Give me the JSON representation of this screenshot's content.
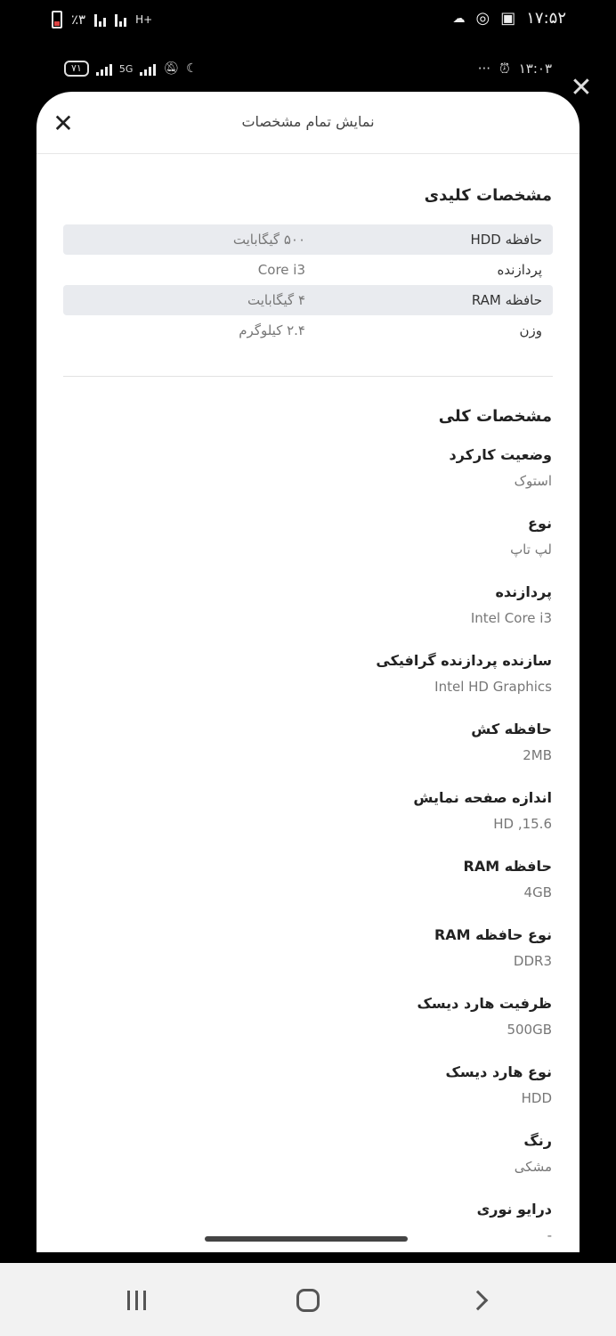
{
  "status_bar": {
    "battery_text": "٪۳",
    "network_type": "H+",
    "time": "۱۷:۵۲"
  },
  "inner_status_bar": {
    "battery_level": "۷۱",
    "network_5g": "5G",
    "dots": "···",
    "time": "۱۳:۰۳"
  },
  "sheet": {
    "title": "نمایش تمام مشخصات",
    "key_specs": {
      "title": "مشخصات کلیدی",
      "rows": [
        {
          "label": "حافظه HDD",
          "value": "۵۰۰ گیگابایت"
        },
        {
          "label": "پردازنده",
          "value": "Core i3"
        },
        {
          "label": "حافظه RAM",
          "value": "۴ گیگابایت"
        },
        {
          "label": "وزن",
          "value": "۲.۴ کیلوگرم"
        }
      ]
    },
    "general_specs": {
      "title": "مشخصات کلی",
      "items": [
        {
          "label": "وضعیت کارکرد",
          "value": "استوک"
        },
        {
          "label": "نوع",
          "value": "لپ تاپ"
        },
        {
          "label": "پردازنده",
          "value": "Intel Core i3"
        },
        {
          "label": "سازنده پردازنده گرافیکی",
          "value": "Intel HD Graphics"
        },
        {
          "label": "حافظه کش",
          "value": "2MB"
        },
        {
          "label": "اندازه صفحه نمایش",
          "value": "HD ,15.6"
        },
        {
          "label": "حافظه RAM",
          "value": "4GB"
        },
        {
          "label": "نوع حافظه RAM",
          "value": "DDR3"
        },
        {
          "label": "ظرفیت هارد دیسک",
          "value": "500GB"
        },
        {
          "label": "نوع هارد دیسک",
          "value": "HDD"
        },
        {
          "label": "رنگ",
          "value": "مشکی"
        },
        {
          "label": "درایو نوری",
          "value": "-"
        }
      ]
    }
  },
  "icons": {
    "close": "close-icon",
    "recent": "recent-apps-icon",
    "home": "home-icon",
    "back": "back-icon"
  }
}
